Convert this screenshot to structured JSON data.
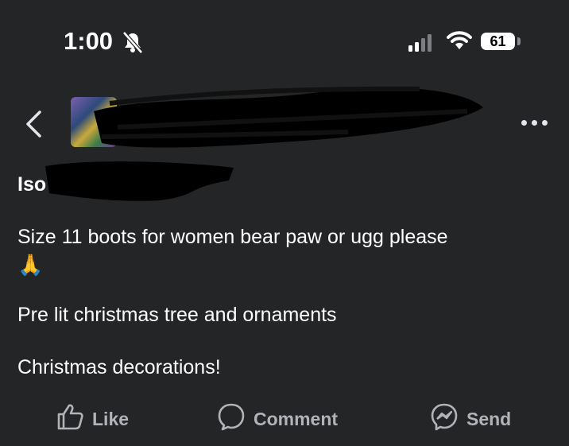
{
  "status_bar": {
    "time": "1:00",
    "battery_level": "61"
  },
  "post": {
    "lines": [
      "Iso",
      "Size 11 boots for women bear paw or ugg please",
      "🙏",
      "Pre lit christmas tree and ornaments",
      "Christmas decorations!"
    ]
  },
  "actions": {
    "like": "Like",
    "comment": "Comment",
    "send": "Send"
  },
  "colors": {
    "background": "#242526",
    "text": "#ffffff",
    "action_text": "#b0b3b8",
    "redaction": "#000000"
  }
}
